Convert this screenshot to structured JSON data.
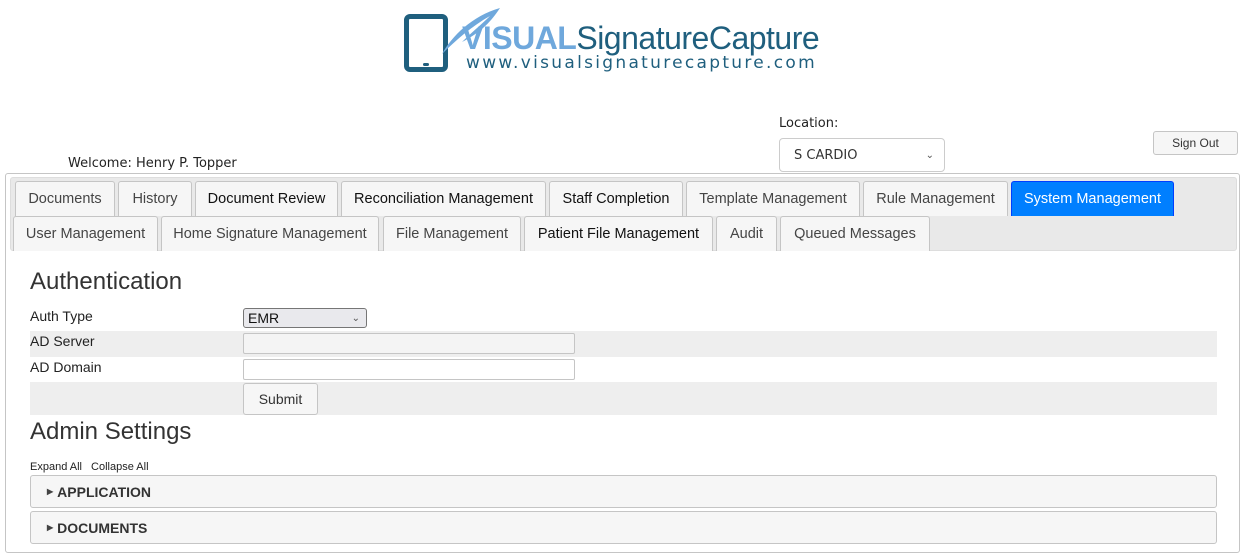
{
  "logo": {
    "brand_bold": "VISUAL",
    "brand_rest": "SignatureCapture",
    "url": "www.visualsignaturecapture.com"
  },
  "header": {
    "welcome": "Welcome: Henry P. Topper",
    "location_label": "Location:",
    "location_value": "S CARDIO",
    "sign_out": "Sign Out"
  },
  "tabs": {
    "row1": [
      {
        "label": "Documents"
      },
      {
        "label": "History"
      },
      {
        "label": "Document Review"
      },
      {
        "label": "Reconciliation Management"
      },
      {
        "label": "Staff Completion"
      },
      {
        "label": "Template Management"
      },
      {
        "label": "Rule Management"
      },
      {
        "label": "System Management",
        "active": true
      }
    ],
    "row2": [
      {
        "label": "User Management"
      },
      {
        "label": "Home Signature Management"
      },
      {
        "label": "File Management"
      },
      {
        "label": "Patient File Management"
      },
      {
        "label": "Audit"
      },
      {
        "label": "Queued Messages"
      }
    ]
  },
  "authentication": {
    "title": "Authentication",
    "auth_type_label": "Auth Type",
    "auth_type_value": "EMR",
    "ad_server_label": "AD Server",
    "ad_server_value": "",
    "ad_domain_label": "AD Domain",
    "ad_domain_value": "",
    "submit": "Submit"
  },
  "admin": {
    "title": "Admin Settings",
    "expand_all": "Expand All",
    "collapse_all": "Collapse All",
    "sections": [
      "APPLICATION",
      "DOCUMENTS"
    ]
  },
  "colors": {
    "active_tab": "#007fff",
    "brand_light": "#6fa8dc",
    "brand_dark": "#1f5f7e"
  }
}
